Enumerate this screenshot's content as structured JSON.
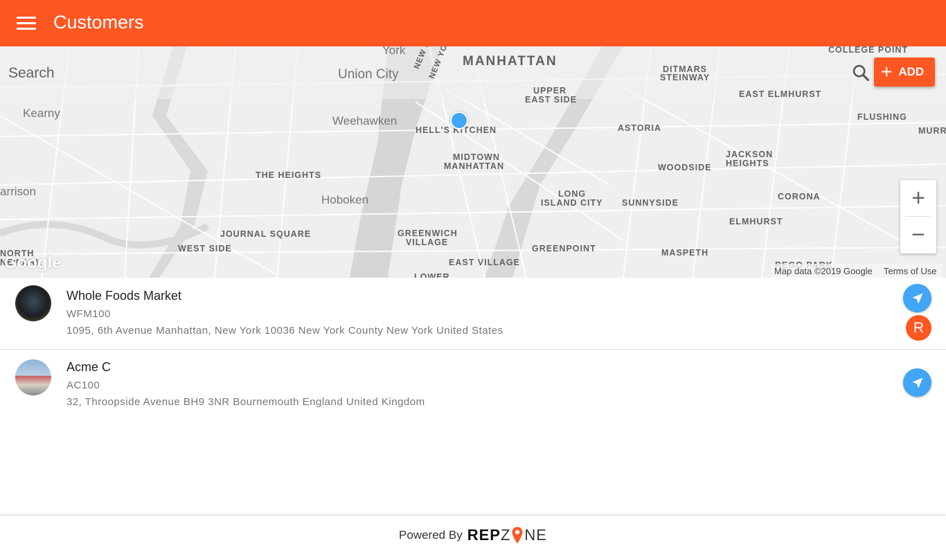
{
  "app_bar": {
    "title": "Customers",
    "menu_icon": "hamburger-menu-icon",
    "background": "#ff5722"
  },
  "map": {
    "search_placeholder": "Search",
    "add_button": {
      "icon": "plus-icon",
      "label": "ADD"
    },
    "zoom_in": "+",
    "zoom_out": "−",
    "logo": "Google",
    "attribution": "Map data ©2019 Google",
    "terms": "Terms of Use",
    "labels": {
      "york": "York",
      "union_city": "Union City",
      "nj_ny": "NEW JERSEY",
      "ny": "NEW YORK",
      "manhattan": "MANHATTAN",
      "ditmars": "DITMARS",
      "steinway": "STEINWAY",
      "college_point": "COLLEGE POINT",
      "east_elmhurst": "EAST ELMHURST",
      "flushing": "FLUSHING",
      "murr": "MURR",
      "kearny": "Kearny",
      "weehawken": "Weehawken",
      "hells_kitchen": "HELL'S KITCHEN",
      "upper": "UPPER",
      "east_side": "EAST SIDE",
      "astoria": "ASTORIA",
      "midtown": "MIDTOWN",
      "manhattan2": "MANHATTAN",
      "the_heights": "THE HEIGHTS",
      "woodside": "WOODSIDE",
      "jackson": "JACKSON",
      "heights": "HEIGHTS",
      "harrison": "arrison",
      "hoboken": "Hoboken",
      "long": "LONG",
      "island_city": "ISLAND CITY",
      "sunnyside": "SUNNYSIDE",
      "corona": "CORONA",
      "journal_square": "JOURNAL SQUARE",
      "greenwich": "GREENWICH",
      "village": "VILLAGE",
      "elmhurst": "ELMHURST",
      "west_side": "WEST SIDE",
      "greenpoint": "GREENPOINT",
      "maspeth": "MASPETH",
      "north": "NORTH",
      "newark": "NEWARK",
      "east_village": "EAST VILLAGE",
      "rego_park": "REGO PARK",
      "lower": "LOWER"
    }
  },
  "customers": [
    {
      "name": "Whole Foods Market",
      "code": "WFM100",
      "address": "1095, 6th Avenue Manhattan, New York 10036 New York County New York United States",
      "badge": "R"
    },
    {
      "name": "Acme C",
      "code": "AC100",
      "address": "32, Throopside Avenue BH9 3NR Bournemouth England United Kingdom"
    }
  ],
  "footer": {
    "powered_by": "Powered By",
    "brand_rep": "REP",
    "brand_z": "Z",
    "brand_ne": "NE"
  },
  "colors": {
    "accent": "#ff5722",
    "nav_button": "#42a5f5"
  }
}
